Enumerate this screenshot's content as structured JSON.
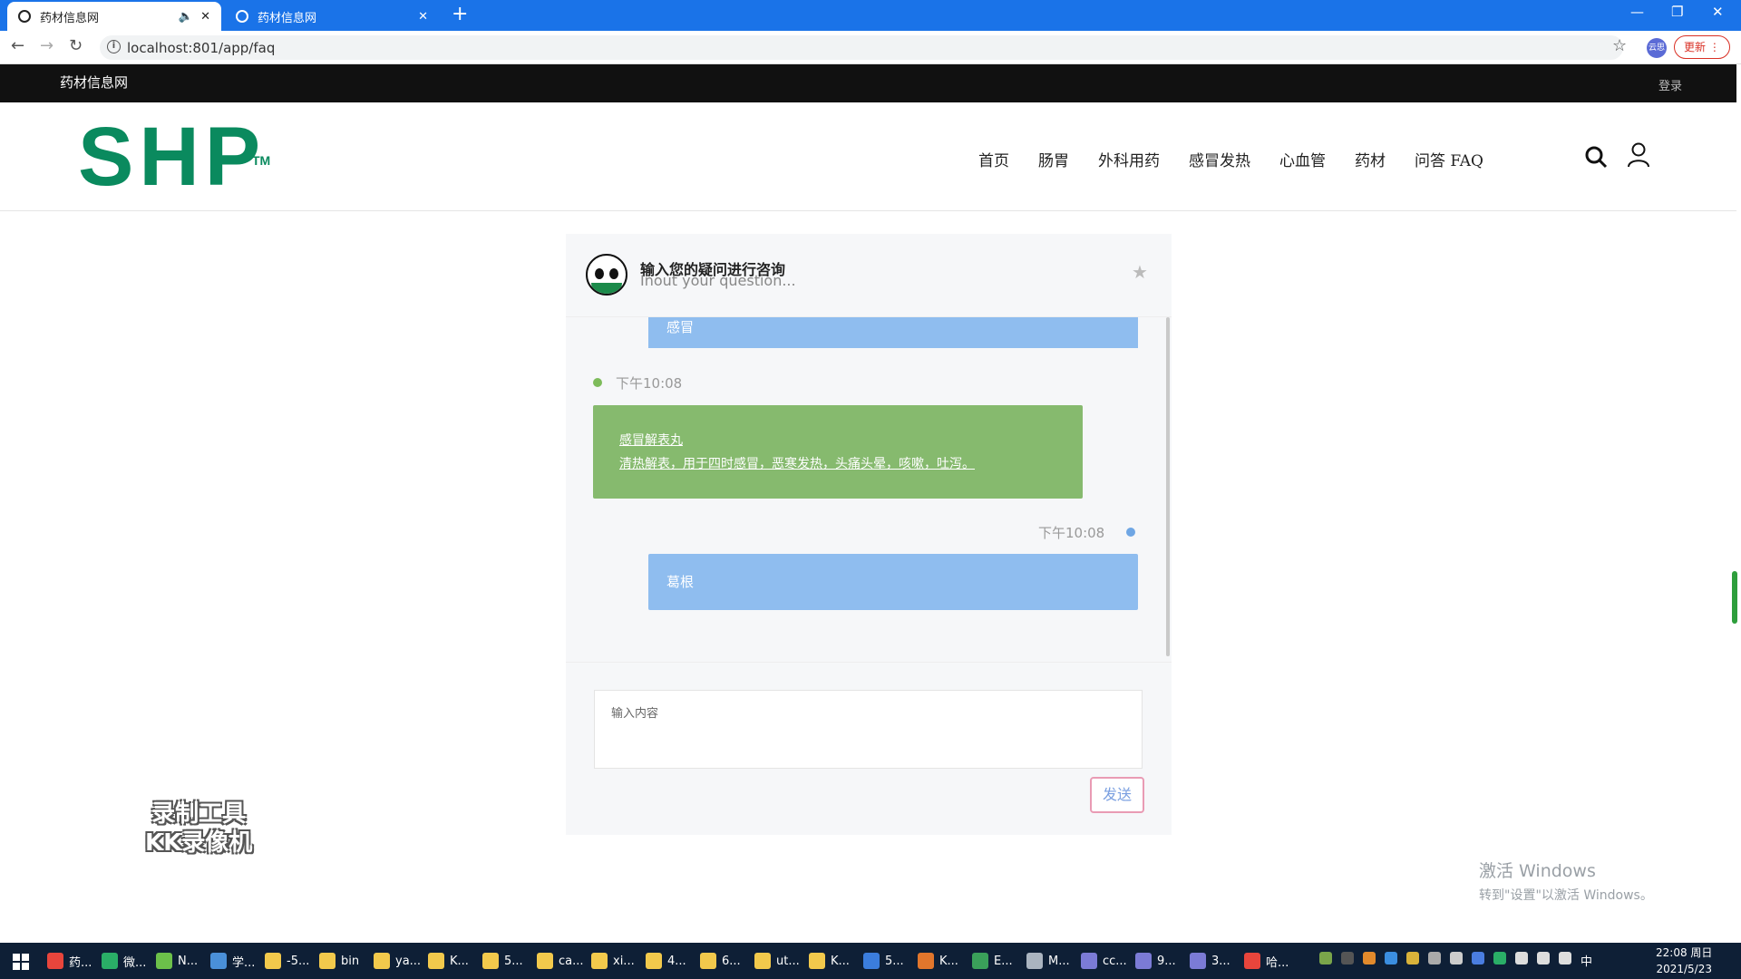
{
  "browser": {
    "tabs": [
      {
        "title": "药材信息网",
        "active": true
      },
      {
        "title": "药材信息网",
        "active": false
      }
    ],
    "url": "localhost:801/app/faq",
    "update_label": "更新",
    "profile_initials": "云思"
  },
  "site": {
    "name": "药材信息网",
    "login": "登录",
    "logo_text": "SHP",
    "logo_tm": "TM",
    "brand_color": "#0a8a5e",
    "nav": [
      "首页",
      "肠胃",
      "外科用药",
      "感冒发热",
      "心血管",
      "药材",
      "问答 FAQ"
    ]
  },
  "chat": {
    "title": "输入您的疑问进行咨询",
    "subtitle": "Inout your question...",
    "messages": [
      {
        "side": "user",
        "text": "感冒",
        "color": "#8fbdef"
      },
      {
        "side": "bot",
        "time": "下午10:08",
        "lines": [
          "感冒解表丸",
          "清热解表，用于四时感冒，恶寒发热，头痛头晕，咳嗽，吐泻。"
        ],
        "color": "#86ba6e"
      },
      {
        "side": "user",
        "time": "下午10:08",
        "text": "葛根",
        "color": "#8fbdef"
      }
    ],
    "input_placeholder": "输入内容",
    "send_label": "发送"
  },
  "watermark": {
    "line1": "录制工具",
    "line2": "KK录像机"
  },
  "activation": {
    "line1": "激活 Windows",
    "line2": "转到\"设置\"以激活 Windows。"
  },
  "taskbar": {
    "items": [
      {
        "label": "药...",
        "icon_color": "#e8453c"
      },
      {
        "label": "微...",
        "icon_color": "#2aae67"
      },
      {
        "label": "N...",
        "icon_color": "#6cc04a"
      },
      {
        "label": "学...",
        "icon_color": "#4a90d9"
      },
      {
        "label": "-5...",
        "icon_color": "#f2c94c"
      },
      {
        "label": "bin",
        "icon_color": "#f2c94c"
      },
      {
        "label": "ya...",
        "icon_color": "#f2c94c"
      },
      {
        "label": "K...",
        "icon_color": "#f2c94c"
      },
      {
        "label": "5...",
        "icon_color": "#f2c94c"
      },
      {
        "label": "ca...",
        "icon_color": "#f2c94c"
      },
      {
        "label": "xi...",
        "icon_color": "#f2c94c"
      },
      {
        "label": "4...",
        "icon_color": "#f2c94c"
      },
      {
        "label": "6...",
        "icon_color": "#f2c94c"
      },
      {
        "label": "ut...",
        "icon_color": "#f2c94c"
      },
      {
        "label": "K...",
        "icon_color": "#f2c94c"
      },
      {
        "label": "5...",
        "icon_color": "#3b7ddd"
      },
      {
        "label": "K...",
        "icon_color": "#e2762c"
      },
      {
        "label": "E...",
        "icon_color": "#3aa05a"
      },
      {
        "label": "M...",
        "icon_color": "#aab4c0"
      },
      {
        "label": "cc...",
        "icon_color": "#7b7bd6"
      },
      {
        "label": "9...",
        "icon_color": "#7b7bd6"
      },
      {
        "label": "3...",
        "icon_color": "#7b7bd6"
      },
      {
        "label": "哈...",
        "icon_color": "#e8453c"
      }
    ],
    "clock_time": "22:08 周日",
    "clock_date": "2021/5/23",
    "ime": "中"
  }
}
